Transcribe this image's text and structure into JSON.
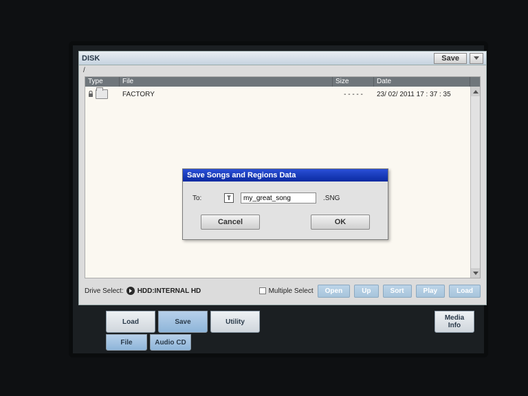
{
  "window": {
    "title": "DISK",
    "path": "/",
    "save_button": "Save"
  },
  "file_list": {
    "headers": {
      "type": "Type",
      "file": "File",
      "size": "Size",
      "date": "Date"
    },
    "rows": [
      {
        "locked": true,
        "kind": "folder",
        "file": "FACTORY",
        "size": "- - - - -",
        "date": "23/ 02/ 2011   17 : 37 : 35"
      }
    ]
  },
  "bottom_bar": {
    "drive_select_label": "Drive Select:",
    "drive_value": "HDD:INTERNAL HD",
    "multiple_select": "Multiple Select",
    "actions": {
      "open": "Open",
      "up": "Up",
      "sort": "Sort",
      "play": "Play",
      "load": "Load"
    }
  },
  "dialog": {
    "title": "Save Songs and Regions Data",
    "field_label": "To:",
    "filename": "my_great_song",
    "extension": ".SNG",
    "cancel": "Cancel",
    "ok": "OK"
  },
  "tabs_upper": {
    "load": "Load",
    "save": "Save",
    "utility": "Utility",
    "media_info": "Media\nInfo"
  },
  "tabs_lower": {
    "file": "File",
    "audio_cd": "Audio CD"
  }
}
